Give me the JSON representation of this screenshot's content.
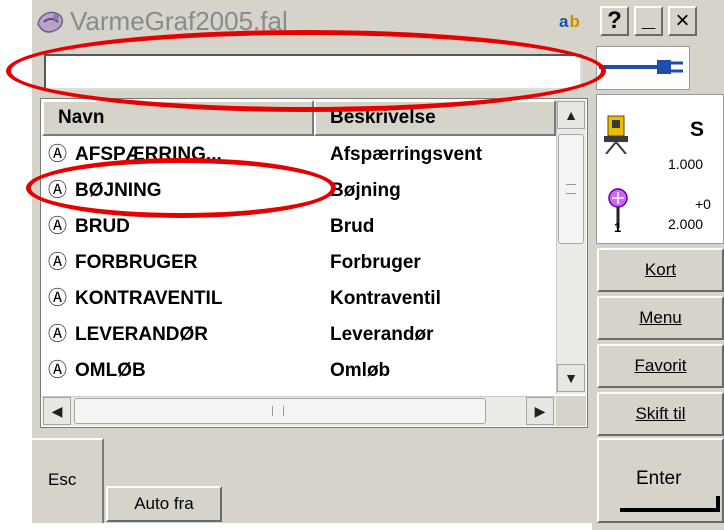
{
  "window": {
    "title": "VarmeGraf2005.fal",
    "input_mode": {
      "a": "a",
      "b": "b"
    }
  },
  "title_buttons": {
    "help": "?",
    "minimize": "_",
    "close": "×"
  },
  "search": {
    "value": "",
    "placeholder": ""
  },
  "table": {
    "columns": [
      "Navn",
      "Beskrivelse"
    ],
    "rows": [
      {
        "prefix": "Ⓐ",
        "name": "AFSPÆRRING...",
        "description": "Afspærringsvent"
      },
      {
        "prefix": "Ⓐ",
        "name": "BØJNING",
        "description": "Bøjning"
      },
      {
        "prefix": "Ⓐ",
        "name": "BRUD",
        "description": "Brud"
      },
      {
        "prefix": "Ⓐ",
        "name": "FORBRUGER",
        "description": "Forbruger"
      },
      {
        "prefix": "Ⓐ",
        "name": "KONTRAVENTIL",
        "description": "Kontraventil"
      },
      {
        "prefix": "Ⓐ",
        "name": "LEVERANDØR",
        "description": "Leverandør"
      },
      {
        "prefix": "Ⓐ",
        "name": "OMLØB",
        "description": "Omløb"
      }
    ]
  },
  "status": {
    "mode": "S",
    "value1": "1.000",
    "offset": "+0",
    "one": "1",
    "value2": "2.000"
  },
  "side_buttons": {
    "kort": "Kort",
    "menu": "Menu",
    "favorit": "Favorit",
    "skift_til": "Skift til"
  },
  "bottom": {
    "esc": "Esc",
    "auto_fra": "Auto fra",
    "enter": "Enter"
  },
  "colors": {
    "annotation": "#e60000",
    "chrome": "#d6d3cb",
    "connector_blue": "#1f4ea8"
  }
}
